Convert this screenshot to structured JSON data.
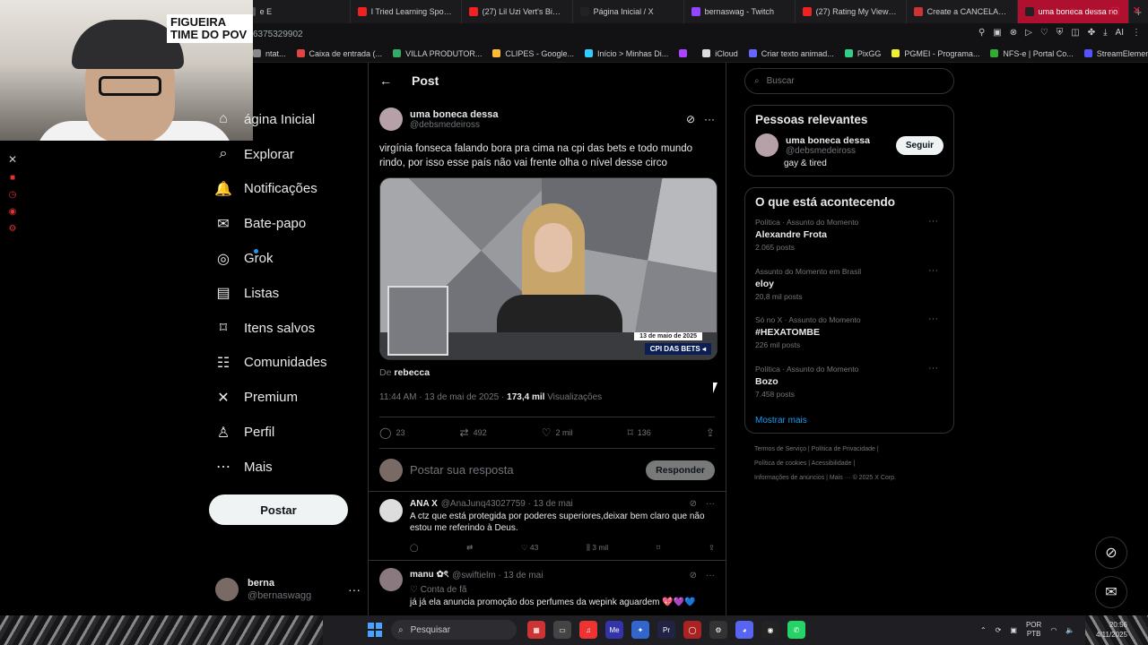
{
  "browser": {
    "tabs": [
      {
        "label": "e E",
        "fav": "#555"
      },
      {
        "label": "I Tried Learning Sports T",
        "fav": "#e22"
      },
      {
        "label": "(27) Lil Uzi Vert's Bigge",
        "fav": "#e22"
      },
      {
        "label": "Página Inicial / X",
        "fav": "#222"
      },
      {
        "label": "bernaswag - Twitch",
        "fav": "#9146ff"
      },
      {
        "label": "(27) Rating My Viewers T",
        "fav": "#e22"
      },
      {
        "label": "Create a CANCELAMENT",
        "fav": "#c33"
      },
      {
        "label": "uma boneca dessa no",
        "fav": "#222"
      }
    ],
    "url": "6375329902",
    "bookmarks": [
      {
        "label": "ntat...",
        "color": "#888"
      },
      {
        "label": "Caixa de entrada (...",
        "color": "#d44"
      },
      {
        "label": "VILLA PRODUTOR...",
        "color": "#3a6"
      },
      {
        "label": "CLIPES - Google...",
        "color": "#fb3"
      },
      {
        "label": "Início > Minhas Di...",
        "color": "#3cf"
      },
      {
        "label": "",
        "color": "#a4f"
      },
      {
        "label": "iCloud",
        "color": "#ddd"
      },
      {
        "label": "Criar texto animad...",
        "color": "#66f"
      },
      {
        "label": "PixGG",
        "color": "#3c8"
      },
      {
        "label": "PGMEI - Programa...",
        "color": "#ee3"
      },
      {
        "label": "NFS-e | Portal Co...",
        "color": "#3a3"
      },
      {
        "label": "StreamElements -...",
        "color": "#55f"
      }
    ]
  },
  "webcam": {
    "overlay_label": "FIGUEIRA TIME DO POV"
  },
  "nav": {
    "items": [
      {
        "label": "ágina Inicial",
        "icon": "home-icon",
        "glyph": "⌂"
      },
      {
        "label": "Explorar",
        "icon": "search-icon",
        "glyph": "⌕"
      },
      {
        "label": "Notificações",
        "icon": "bell-icon",
        "glyph": "🔔"
      },
      {
        "label": "Bate-papo",
        "icon": "mail-icon",
        "glyph": "✉"
      },
      {
        "label": "Grok",
        "icon": "grok-icon",
        "glyph": "◎"
      },
      {
        "label": "Listas",
        "icon": "list-icon",
        "glyph": "▤"
      },
      {
        "label": "Itens salvos",
        "icon": "bookmark-icon",
        "glyph": "⌑"
      },
      {
        "label": "Comunidades",
        "icon": "communities-icon",
        "glyph": "☷"
      },
      {
        "label": "Premium",
        "icon": "x-logo-icon",
        "glyph": "✕"
      },
      {
        "label": "Perfil",
        "icon": "profile-icon",
        "glyph": "♙"
      },
      {
        "label": "Mais",
        "icon": "more-icon",
        "glyph": "⋯"
      }
    ],
    "post_button": "Postar",
    "user": {
      "name": "berna",
      "handle": "@bernaswagg"
    }
  },
  "post": {
    "header": "Post",
    "author_name": "uma boneca dessa",
    "author_handle": "@debsmedeiross",
    "text": "virgínia fonseca falando bora pra cima na cpi das bets e todo mundo rindo, por isso esse país não vai frente olha o nível desse circo",
    "media_date": "13 de maio de 2025",
    "media_tag": "CPI DAS BETS ◂",
    "from_prefix": "De",
    "from_user": "rebecca",
    "timestamp": "11:44 AM · 13 de mai de 2025 ·",
    "views_count": "173,4 mil",
    "views_label": "Visualizações",
    "stats": {
      "replies": "23",
      "reposts": "492",
      "likes": "2 mil",
      "bookmarks": "136"
    },
    "reply_placeholder": "Postar sua resposta",
    "reply_button": "Responder"
  },
  "replies": [
    {
      "name": "ANA X",
      "handle": "@AnaJunq43027759 · 13 de mai",
      "fan": "",
      "text": "A ctz que está protegida por poderes superiores,deixar bem claro que não estou me referindo à Deus.",
      "likes": "43",
      "views": "3 mil"
    },
    {
      "name": "manu ✿ৎ",
      "handle": "@swiftielm · 13 de mai",
      "fan": "♡ Conta de fã",
      "text": "já já ela anuncia promoção dos perfumes da wepink aguardem 💖💜💙",
      "likes": "",
      "views": ""
    }
  ],
  "sidebar": {
    "search_placeholder": "Buscar",
    "relevant_title": "Pessoas relevantes",
    "relevant": {
      "name": "uma boneca dessa",
      "handle": "@debsmedeiross",
      "bio": "gay & tired",
      "follow": "Seguir"
    },
    "trending_title": "O que está acontecendo",
    "trends": [
      {
        "context": "Política · Assunto do Momento",
        "title": "Alexandre Frota",
        "count": "2.065 posts"
      },
      {
        "context": "Assunto do Momento em Brasil",
        "title": "eloy",
        "count": "20,8 mil posts"
      },
      {
        "context": "Só no X · Assunto do Momento",
        "title": "#HEXATOMBE",
        "count": "226 mil posts"
      },
      {
        "context": "Política · Assunto do Momento",
        "title": "Bozo",
        "count": "7.458 posts"
      }
    ],
    "show_more": "Mostrar mais",
    "footer_line1": "Termos de Serviço  |  Política de Privacidade  |",
    "footer_line2": "Política de cookies  |  Acessibilidade  |",
    "footer_line3": "Informações de anúncios  |  Mais ···  © 2025 X Corp."
  },
  "taskbar": {
    "search": "Pesquisar",
    "lang1": "POR",
    "lang2": "PTB",
    "time": "20:56",
    "date": "4/11/2025"
  }
}
